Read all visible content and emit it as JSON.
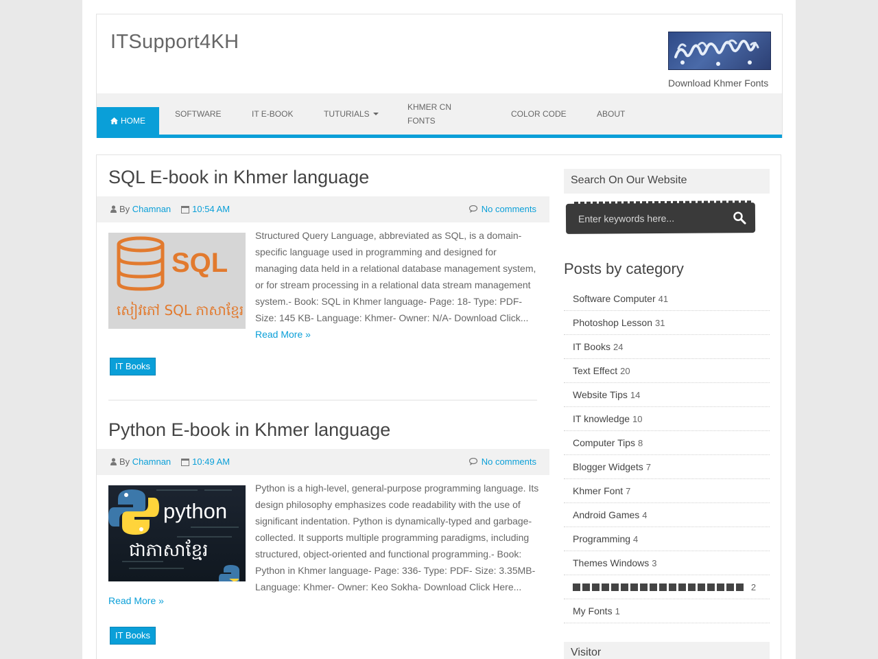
{
  "site": {
    "title": "ITSupport4KH",
    "banner_caption": "Download Khmer Fonts"
  },
  "nav": {
    "items": [
      {
        "label": "HOME",
        "icon": "home-icon"
      },
      {
        "label": "SOFTWARE"
      },
      {
        "label": "IT E-BOOK"
      },
      {
        "label": "TUTURIALS"
      },
      {
        "label": "KHMER CN FONTS"
      },
      {
        "label": "COLOR CODE"
      },
      {
        "label": "ABOUT"
      }
    ]
  },
  "posts": [
    {
      "title": "SQL E-book in Khmer language",
      "by": "By",
      "author": "Chamnan",
      "time": "10:54 AM",
      "comments": "No comments",
      "thumb_text": "SQL",
      "thumb_khmer": "សៀវភៅ SQL ភាសាខ្មែរ",
      "excerpt": " Structured Query Language, abbreviated as SQL, is a domain-specific language used in programming and designed for managing data held in a relational database management system, or for stream processing in a relational data stream management system.- Book: SQL in Khmer language- Page: 18- Type: PDF- Size: 145 KB- Language: Khmer- Owner: N/A- Download Click...",
      "read_more": "Read More »",
      "label": "IT Books"
    },
    {
      "title": "Python E-book in Khmer language",
      "by": "By",
      "author": "Chamnan",
      "time": "10:49 AM",
      "comments": "No comments",
      "thumb_text": "python",
      "thumb_khmer": "ជាភាសាខ្មែរ",
      "excerpt": " Python is a high-level, general-purpose programming language. Its design philosophy emphasizes code readability with the use of significant indentation. Python is dynamically-typed and garbage-collected. It supports multiple programming paradigms, including structured, object-oriented and functional programming.- Book: Python in Khmer language- Page: 336- Type: PDF- Size: 3.35MB- Language: Khmer- Owner: Keo Sokha- Download Click Here...",
      "read_more": "Read More »",
      "label": "IT Books"
    }
  ],
  "sidebar": {
    "search_title": "Search On Our Website",
    "search_placeholder": "Enter keywords here...",
    "categories_title": "Posts by category",
    "categories": [
      {
        "name": "Software Computer",
        "count": "41"
      },
      {
        "name": "Photoshop Lesson",
        "count": "31"
      },
      {
        "name": "IT Books",
        "count": "24"
      },
      {
        "name": "Text Effect",
        "count": "20"
      },
      {
        "name": "Website Tips",
        "count": "14"
      },
      {
        "name": "IT knowledge",
        "count": "10"
      },
      {
        "name": "Computer Tips",
        "count": "8"
      },
      {
        "name": "Blogger Widgets",
        "count": "7"
      },
      {
        "name": "Khmer Font",
        "count": "7"
      },
      {
        "name": "Android Games",
        "count": "4"
      },
      {
        "name": "Programming",
        "count": "4"
      },
      {
        "name": "Themes Windows",
        "count": "3"
      },
      {
        "name": "",
        "count": "2"
      },
      {
        "name": "My Fonts",
        "count": "1"
      }
    ],
    "visitor_title": "Visitor"
  },
  "colors": {
    "accent": "#0a9fd8",
    "sql_orange": "#e27a2e"
  }
}
